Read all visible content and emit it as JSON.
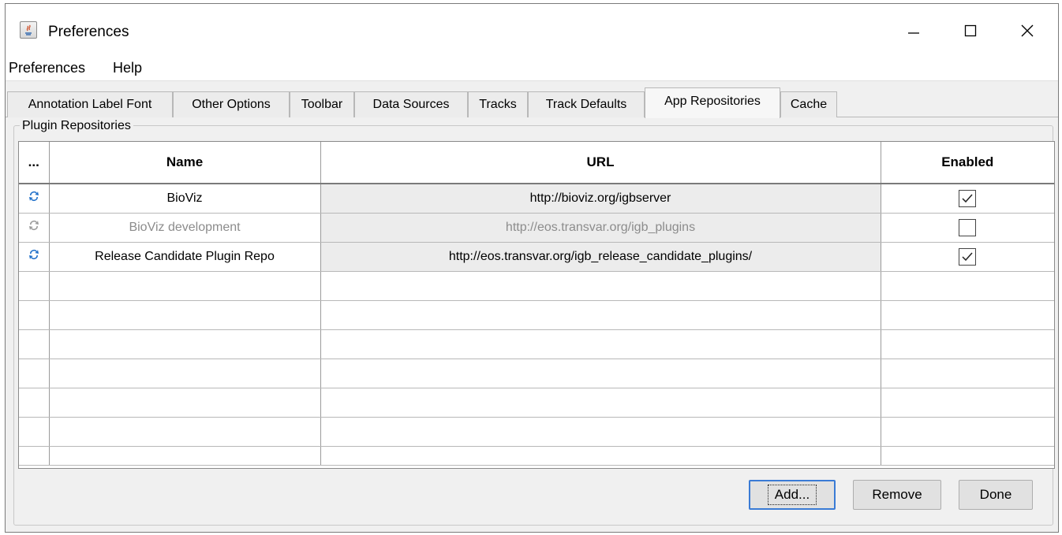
{
  "window": {
    "title": "Preferences",
    "controls": {
      "minimize": "—",
      "maximize": "☐",
      "close": "✕"
    }
  },
  "menu": {
    "items": [
      "Preferences",
      "Help"
    ]
  },
  "tabs": [
    {
      "label": "Annotation Label Font",
      "active": false
    },
    {
      "label": "Other Options",
      "active": false
    },
    {
      "label": "Toolbar",
      "active": false
    },
    {
      "label": "Data Sources",
      "active": false
    },
    {
      "label": "Tracks",
      "active": false
    },
    {
      "label": "Track Defaults",
      "active": false
    },
    {
      "label": "App Repositories",
      "active": true
    },
    {
      "label": "Cache",
      "active": false
    }
  ],
  "group": {
    "title": "Plugin Repositories"
  },
  "table": {
    "columns": {
      "refresh": "...",
      "name": "Name",
      "url": "URL",
      "enabled": "Enabled"
    },
    "rows": [
      {
        "name": "BioViz",
        "url": "http://bioviz.org/igbserver",
        "enabled": true
      },
      {
        "name": "BioViz development",
        "url": "http://eos.transvar.org/igb_plugins",
        "enabled": false
      },
      {
        "name": "Release Candidate Plugin Repo",
        "url": "http://eos.transvar.org/igb_release_candidate_plugins/",
        "enabled": true
      }
    ]
  },
  "buttons": {
    "add": "Add...",
    "remove": "Remove",
    "done": "Done"
  },
  "colors": {
    "refresh_active": "#1f6fc9",
    "refresh_disabled": "#9a9a9a",
    "focus_border": "#3a7bd5"
  }
}
